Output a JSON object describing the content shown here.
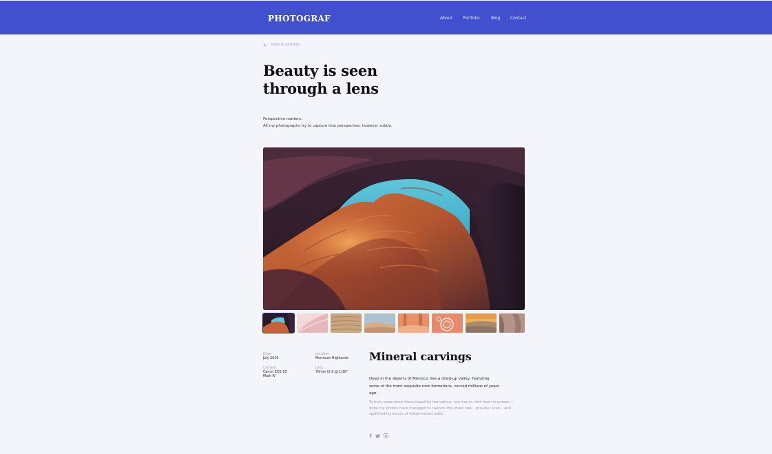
{
  "header": {
    "logo": "PHOTOGRAF",
    "nav": [
      "About",
      "Portfolio",
      "Blog",
      "Contact"
    ]
  },
  "back_link": "Back to portfolio",
  "hero": {
    "title_line1": "Beauty is seen",
    "title_line2": "through a lens",
    "intro_line1": "Perspective matters.",
    "intro_line2": "All my photographs try to capture that perspective, however subtle."
  },
  "main_photo_alt": "Antelope canyon rock formation with sky opening",
  "thumbnails": [
    "canyon-arch",
    "pink-dunes",
    "sand-ripples",
    "desert-dunes",
    "orange-canyon",
    "round-pools",
    "sunset-dunes",
    "canyon-walls"
  ],
  "meta": {
    "date_label": "Date",
    "date_value": "July 2019",
    "location_label": "Location",
    "location_value": "Morrocan Highlands",
    "camera_label": "Camera",
    "camera_value_line1": "Canon EOS 1D",
    "camera_value_line2": "Mark IV",
    "lens_label": "Lens",
    "lens_value": "70mm f2.8 @ 1/16\""
  },
  "section": {
    "title": "Mineral carvings",
    "desc1_line1": "Deep in the deserts of Morroco, lies a dried-up valley, featuring",
    "desc1_line2": "some of the most exquisite rock formations, carved millions of years",
    "desc1_line3": "ago.",
    "desc2_line1": "To truly experience these beautiful formations, one has to visit them in person. I",
    "desc2_line2": "hope my photos have managed to capture the sheer size – gravitas even – and",
    "desc2_line3": "spellbinding nature of these eroded walls."
  },
  "social_icons": [
    "facebook-icon",
    "twitter-icon",
    "instagram-icon"
  ],
  "colors": {
    "header_bg": "#4250cf",
    "page_bg": "#f4f5fb"
  }
}
